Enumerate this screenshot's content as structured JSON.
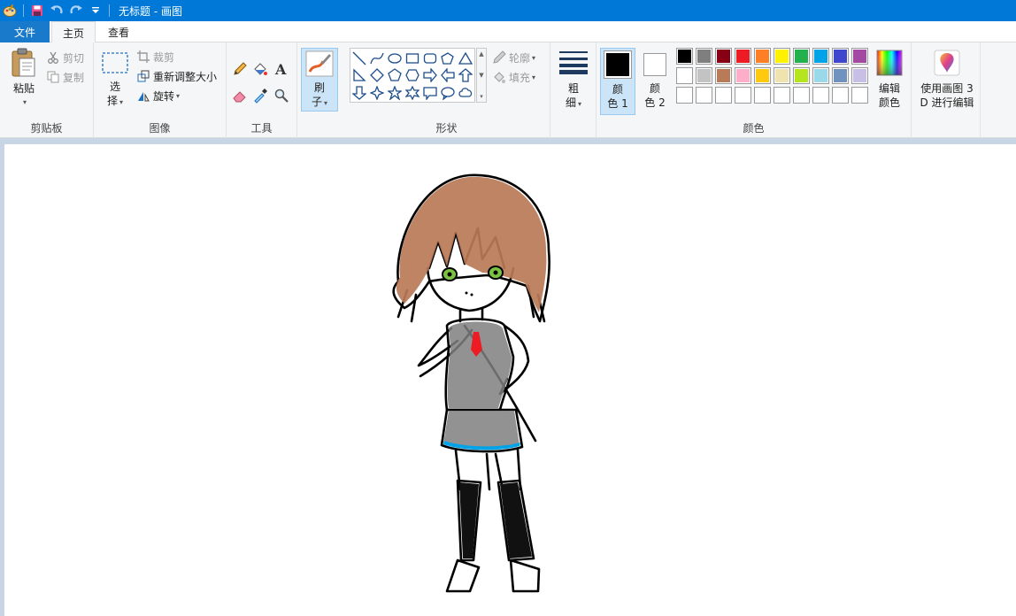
{
  "window": {
    "title": "无标题 - 画图"
  },
  "tabs": {
    "file": "文件",
    "home": "主页",
    "view": "查看"
  },
  "clipboard": {
    "paste": "粘贴",
    "cut": "剪切",
    "copy": "复制",
    "label": "剪贴板"
  },
  "image": {
    "select_line1": "选",
    "select_line2": "择",
    "crop": "裁剪",
    "resize": "重新调整大小",
    "rotate": "旋转",
    "label": "图像"
  },
  "tools": {
    "label": "工具"
  },
  "brushes": {
    "line1": "刷",
    "line2": "子"
  },
  "shapes": {
    "outline": "轮廓",
    "fill": "填充",
    "label": "形状"
  },
  "size": {
    "line1": "粗",
    "line2": "细"
  },
  "colors": {
    "color1_line1": "颜",
    "color1_line2": "色 1",
    "color2_line1": "颜",
    "color2_line2": "色 2",
    "color1_value": "#000000",
    "color2_value": "#ffffff",
    "palette_row1": [
      "#000000",
      "#7f7f7f",
      "#880015",
      "#ed1c24",
      "#ff7f27",
      "#fff200",
      "#22b14c",
      "#00a2e8",
      "#3f48cc",
      "#a349a4"
    ],
    "palette_row2": [
      "#ffffff",
      "#c3c3c3",
      "#b97a57",
      "#ffaec9",
      "#ffc90e",
      "#efe4b0",
      "#b5e61d",
      "#99d9ea",
      "#7092be",
      "#c8bfe7"
    ],
    "edit_line1": "编辑",
    "edit_line2": "颜色",
    "label": "颜色"
  },
  "paint3d": {
    "line1": "使用画图 3",
    "line2": "D 进行编辑"
  },
  "drawing": {
    "hair": "#b97a57",
    "eyes": "#7cc242",
    "outfit": "#7f7f7f",
    "tie": "#ed1c24",
    "stripe": "#00a2e8"
  }
}
